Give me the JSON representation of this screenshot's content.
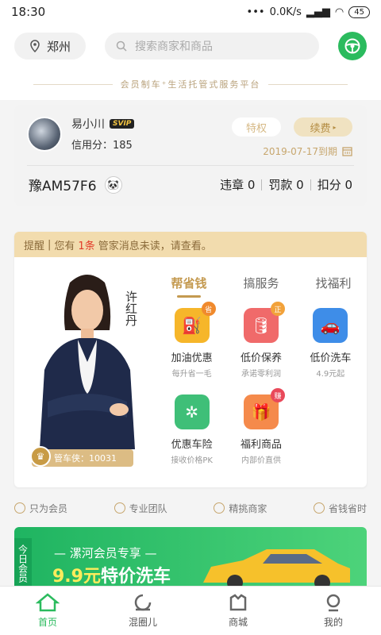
{
  "status": {
    "time": "18:30",
    "speed": "0.0K/s",
    "battery": "45"
  },
  "header": {
    "city": "郑州",
    "search_placeholder": "搜索商家和商品"
  },
  "tagline": "会员制车⁺生活托管式服务平台",
  "member": {
    "name": "易小川",
    "badge": "SVIP",
    "credit": "信用分：185",
    "privilege_label": "特权",
    "renew_label": "续费",
    "expire": "2019-07-17到期",
    "plate": "豫AM57F6",
    "violations": "违章 0",
    "fines": "罚款 0",
    "points": "扣分 0"
  },
  "notice": {
    "label": "提醒",
    "text_pre": "您有",
    "count": "1条",
    "text_post": "管家消息未读，请查看。"
  },
  "manager": {
    "signature": "许红丹",
    "id_text": "管车侠：10031"
  },
  "tabs": [
    "帮省钱",
    "搞服务",
    "找福利"
  ],
  "services": [
    {
      "title": "加油优惠",
      "sub": "每升省一毛",
      "badge": "省",
      "color": "#f6b62a",
      "badge_color": "#f08a2d",
      "icon": "fuel-icon",
      "glyph": "⛽"
    },
    {
      "title": "低价保养",
      "sub": "承诺零利润",
      "badge": "正",
      "color": "#f06a6a",
      "badge_color": "#f2a23a",
      "icon": "oil-icon",
      "glyph": "🛢"
    },
    {
      "title": "低价洗车",
      "sub": "4.9元起",
      "badge": "",
      "color": "#3e8de8",
      "badge_color": "",
      "icon": "car-wash-icon",
      "glyph": "🚗"
    },
    {
      "title": "优惠车险",
      "sub": "接收价格PK",
      "badge": "",
      "color": "#3fbf78",
      "badge_color": "",
      "icon": "insurance-icon",
      "glyph": "✲"
    },
    {
      "title": "福利商品",
      "sub": "内部价直供",
      "badge": "赚",
      "color": "#f58a4b",
      "badge_color": "#e9495a",
      "icon": "gift-icon",
      "glyph": "🎁"
    }
  ],
  "features": [
    "只为会员",
    "专业团队",
    "精挑商家",
    "省钱省时"
  ],
  "banner": {
    "side": "今日会员",
    "sub": "— 漯河会员专享 —",
    "price": "9.9元",
    "title": "特价洗车"
  },
  "tabbar": [
    "首页",
    "混圈儿",
    "商城",
    "我的"
  ]
}
